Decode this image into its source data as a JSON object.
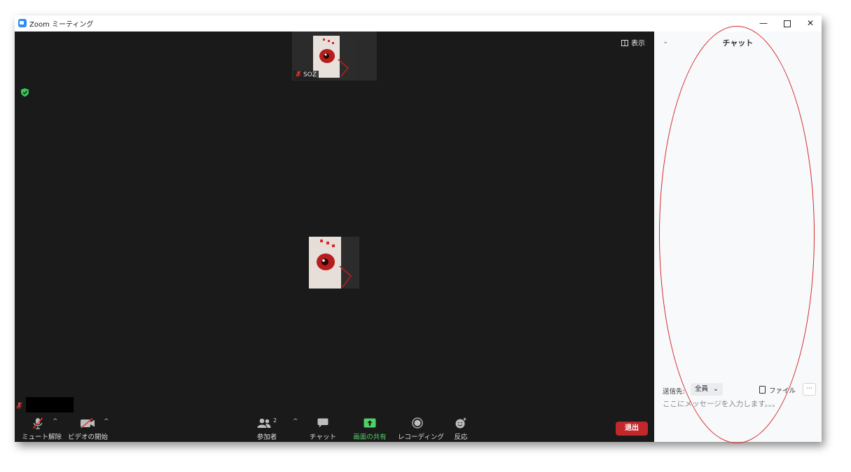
{
  "window": {
    "title": "Zoom ミーティング",
    "minimize_icon": "minimize-icon",
    "maximize_icon": "maximize-icon",
    "close_icon": "close-icon"
  },
  "meeting": {
    "view_label": "表示",
    "thumbnail": {
      "name": "SOZ",
      "muted": true
    },
    "self_muted": true
  },
  "toolbar": {
    "unmute": "ミュート解除",
    "start_video": "ビデオの開始",
    "participants": "参加者",
    "participants_count": "2",
    "chat": "チャット",
    "share_screen": "画面の共有",
    "recording": "レコーディング",
    "reactions": "反応",
    "leave": "退出"
  },
  "chat_panel": {
    "title": "チャット",
    "send_to_label": "送信先:",
    "send_to_value": "全員",
    "file_label": "ファイル",
    "more_label": "···",
    "input_placeholder": "ここにメッセージを入力します。。。"
  },
  "colors": {
    "share_green": "#4fd166",
    "leave_red": "#c0282b",
    "zoom_blue": "#2d8cff",
    "annotation": "#d42a2a"
  }
}
